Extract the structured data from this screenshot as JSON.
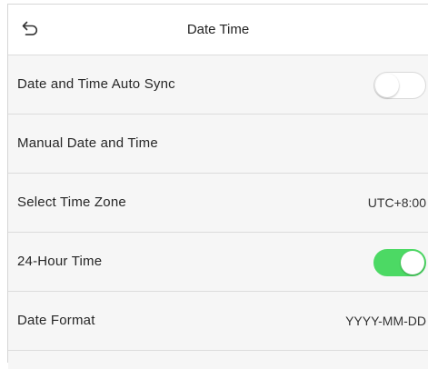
{
  "header": {
    "title": "Date Time",
    "back_icon": "back-arrow-icon"
  },
  "colors": {
    "toggle_on": "#4cd964",
    "toggle_off": "#ffffff",
    "row_background": "#f6f6f6",
    "divider": "#dcdcdc"
  },
  "settings": {
    "auto_sync": {
      "label": "Date and Time Auto Sync",
      "enabled": false
    },
    "manual": {
      "label": "Manual Date and Time"
    },
    "time_zone": {
      "label": "Select Time Zone",
      "value": "UTC+8:00"
    },
    "hour24": {
      "label": "24-Hour Time",
      "enabled": true
    },
    "date_format": {
      "label": "Date Format",
      "value": "YYYY-MM-DD"
    }
  }
}
